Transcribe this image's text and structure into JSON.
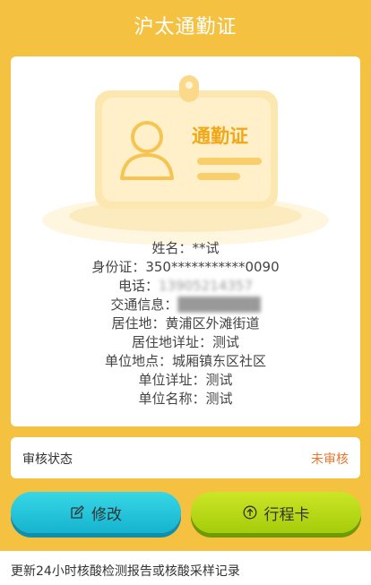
{
  "header": {
    "title": "沪太通勤证"
  },
  "card": {
    "badge_text": "通勤证",
    "fields": [
      {
        "label": "姓名：",
        "value": "**试",
        "masked": false
      },
      {
        "label": "身份证：",
        "value": "350***********0090",
        "masked": false
      },
      {
        "label": "电话：",
        "value": "13905214357",
        "masked": true
      },
      {
        "label": "交通信息：",
        "value": "████████",
        "masked": true
      },
      {
        "label": "居住地：",
        "value": "黄浦区外滩街道",
        "masked": false
      },
      {
        "label": "居住地详址：",
        "value": "测试",
        "masked": false
      },
      {
        "label": "单位地点：",
        "value": "城厢镇东区社区",
        "masked": false
      },
      {
        "label": "单位详址：",
        "value": "测试",
        "masked": false
      },
      {
        "label": "单位名称：",
        "value": "测试",
        "masked": false
      }
    ]
  },
  "status": {
    "label": "审核状态",
    "value": "未审核",
    "value_color": "#e8762b"
  },
  "buttons": {
    "edit_label": "修改",
    "trip_label": "行程卡"
  },
  "footer": {
    "text": "更新24小时核酸检测报告或核酸采样记录"
  },
  "colors": {
    "background": "#f5c141",
    "edit_button": "#1fbfd8",
    "trip_button": "#b5d816"
  }
}
